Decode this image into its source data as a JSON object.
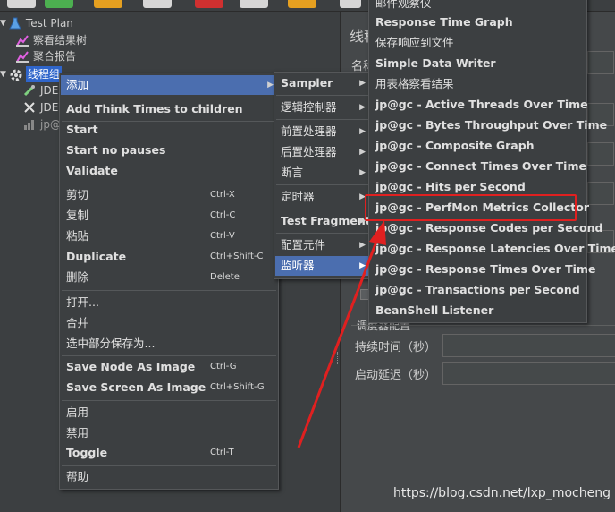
{
  "tree": {
    "items": [
      {
        "label": "Test Plan",
        "icon": "flask-icon"
      },
      {
        "label": "察看结果树",
        "icon": "chart-icon"
      },
      {
        "label": "聚合报告",
        "icon": "chart-icon"
      },
      {
        "label": "线程组",
        "icon": "gear-icon"
      },
      {
        "label": "JDE",
        "icon": "pipette-icon"
      },
      {
        "label": "JDE",
        "icon": "tools-icon"
      },
      {
        "label": "jp@",
        "icon": "chart-icon"
      }
    ]
  },
  "right_pane": {
    "title": "线程",
    "name_label": "名称",
    "scheduler_section": "调度器配置",
    "duration_label": "持续时间（秒）",
    "delay_label": "启动延迟（秒）"
  },
  "context_menu": {
    "add": "添加",
    "add_think_times": "Add Think Times to children",
    "start": "Start",
    "start_no_pauses": "Start no pauses",
    "validate": "Validate",
    "cut": "剪切",
    "cut_sc": "Ctrl-X",
    "copy": "复制",
    "copy_sc": "Ctrl-C",
    "paste": "粘贴",
    "paste_sc": "Ctrl-V",
    "duplicate": "Duplicate",
    "duplicate_sc": "Ctrl+Shift-C",
    "delete": "删除",
    "delete_sc": "Delete",
    "open": "打开...",
    "merge": "合并",
    "save_selection": "选中部分保存为...",
    "save_node_image": "Save Node As Image",
    "save_node_image_sc": "Ctrl-G",
    "save_screen_image": "Save Screen As Image",
    "save_screen_image_sc": "Ctrl+Shift-G",
    "enable": "启用",
    "disable": "禁用",
    "toggle": "Toggle",
    "toggle_sc": "Ctrl-T",
    "help": "帮助"
  },
  "add_submenu": {
    "sampler": "Sampler",
    "logic_controller": "逻辑控制器",
    "pre_processor": "前置处理器",
    "post_processor": "后置处理器",
    "assertion": "断言",
    "timer": "定时器",
    "test_fragment": "Test Fragment",
    "config_element": "配置元件",
    "listener": "监听器"
  },
  "listener_submenu": {
    "items": [
      "邮件观察仪",
      "Response Time Graph",
      "保存响应到文件",
      "Simple Data Writer",
      "用表格察看结果",
      "jp@gc - Active Threads Over Time",
      "jp@gc - Bytes Throughput Over Time",
      "jp@gc - Composite Graph",
      "jp@gc - Connect Times Over Time",
      "jp@gc - Hits per Second",
      "jp@gc - PerfMon Metrics Collector",
      "jp@gc - Response Codes per Second",
      "jp@gc - Response Latencies Over Time",
      "jp@gc - Response Times Over Time",
      "jp@gc - Transactions per Second",
      "BeanShell Listener"
    ]
  },
  "watermark": "https://blog.csdn.net/lxp_mocheng",
  "colors": {
    "highlight": "#4b6eaf",
    "annotation": "#e02020"
  }
}
